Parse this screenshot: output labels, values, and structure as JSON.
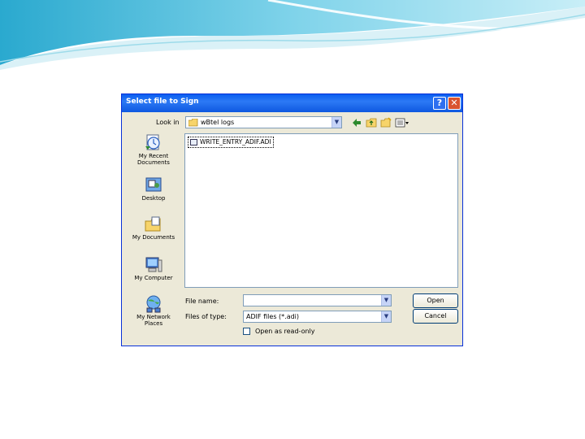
{
  "dialog": {
    "title": "Select file to Sign",
    "help_button": "?",
    "close_button": "✕"
  },
  "look_in": {
    "label": "Look in",
    "value": "wBtel logs"
  },
  "places": [
    {
      "label": "My Recent Documents"
    },
    {
      "label": "Desktop"
    },
    {
      "label": "My Documents"
    },
    {
      "label": "My Computer"
    },
    {
      "label": "My Network Places"
    }
  ],
  "files": [
    {
      "name": "WRITE_ENTRY_ADIF.ADI"
    }
  ],
  "file_name": {
    "label": "File name:",
    "value": ""
  },
  "file_type": {
    "label": "Files of type:",
    "value": "ADIF files (*.adi)"
  },
  "open_button": "Open",
  "cancel_button": "Cancel",
  "read_only": {
    "label": "Open as read-only",
    "checked": false
  },
  "colors": {
    "title_bar": "#0a5ef0",
    "dialog_face": "#ece9d8",
    "slide_accent": "#3ab4d4"
  }
}
